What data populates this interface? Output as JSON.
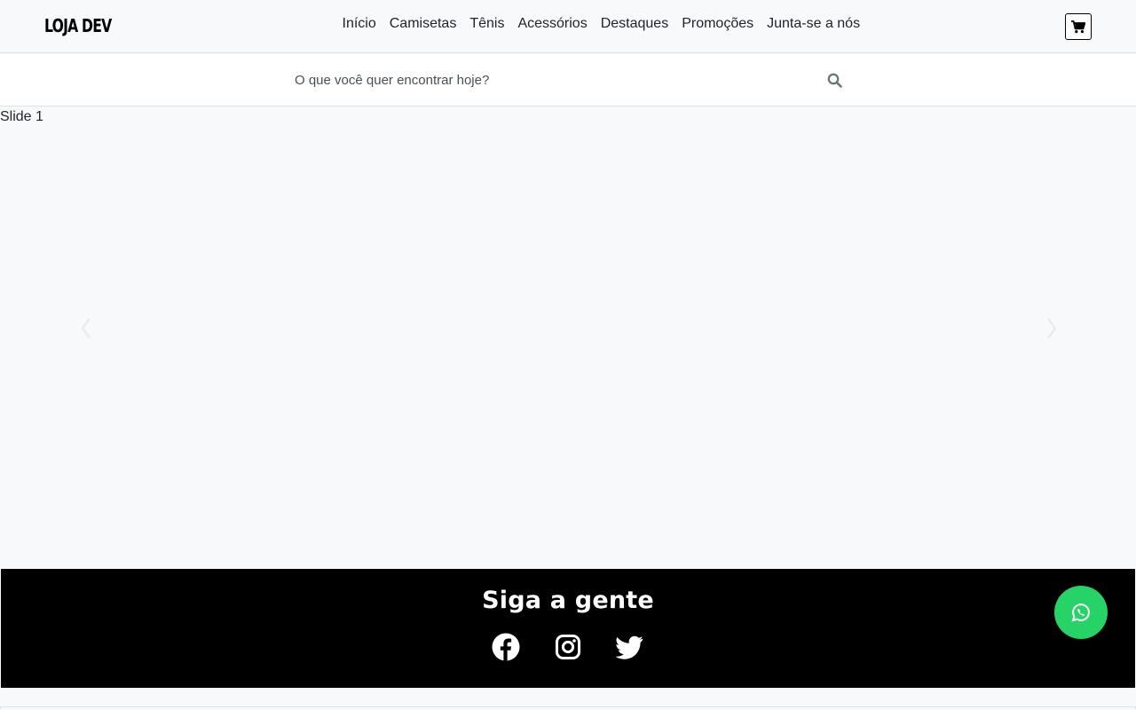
{
  "brand": {
    "logo_text": "LOJA DEV"
  },
  "nav": {
    "items": [
      {
        "label": "Início"
      },
      {
        "label": "Camisetas"
      },
      {
        "label": "Tênis"
      },
      {
        "label": "Acessórios"
      },
      {
        "label": "Destaques"
      },
      {
        "label": "Promoções"
      },
      {
        "label": "Junta-se a nós"
      }
    ]
  },
  "header": {
    "cart_icon": "shopping-cart-icon"
  },
  "search": {
    "placeholder": "O que você quer encontrar hoje?",
    "icon": "search-icon"
  },
  "carousel": {
    "slide_alt": "Slide 1",
    "prev_icon": "chevron-left-icon",
    "next_icon": "chevron-right-icon"
  },
  "social": {
    "title": "Siga a gente",
    "links": [
      {
        "icon": "facebook-icon"
      },
      {
        "icon": "instagram-icon"
      },
      {
        "icon": "twitter-icon"
      }
    ]
  },
  "floating": {
    "icon": "whatsapp-icon",
    "color": "#25d366"
  },
  "colors": {
    "footer_bg": "#000000",
    "page_bg": "#f8f9fa"
  }
}
